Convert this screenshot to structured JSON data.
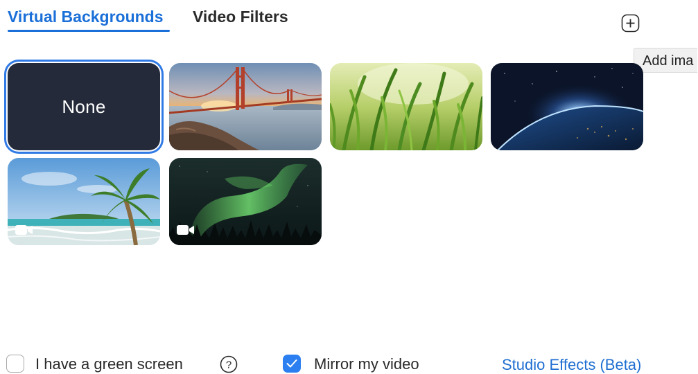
{
  "tabs": {
    "virtual_backgrounds": "Virtual Backgrounds",
    "video_filters": "Video Filters",
    "active": "virtual_backgrounds"
  },
  "add_image": {
    "icon": "plus-circle-icon",
    "tooltip": "Add ima"
  },
  "backgrounds": {
    "none_label": "None",
    "items": [
      {
        "name": "none",
        "selected": true
      },
      {
        "name": "golden-gate-bridge",
        "is_video": false
      },
      {
        "name": "grass",
        "is_video": false
      },
      {
        "name": "earth-from-space",
        "is_video": false
      },
      {
        "name": "tropical-beach",
        "is_video": true
      },
      {
        "name": "aurora",
        "is_video": true
      }
    ]
  },
  "options": {
    "green_screen": {
      "label": "I have a green screen",
      "checked": false
    },
    "mirror_video": {
      "label": "Mirror my video",
      "checked": true
    },
    "help_icon": "question-circle-icon",
    "studio_effects": "Studio Effects (Beta)"
  },
  "colors": {
    "accent": "#1a6fd8",
    "selection_ring": "#2f7ae5",
    "checkbox_checked": "#2b7ff0",
    "none_tile": "#252a3a"
  }
}
